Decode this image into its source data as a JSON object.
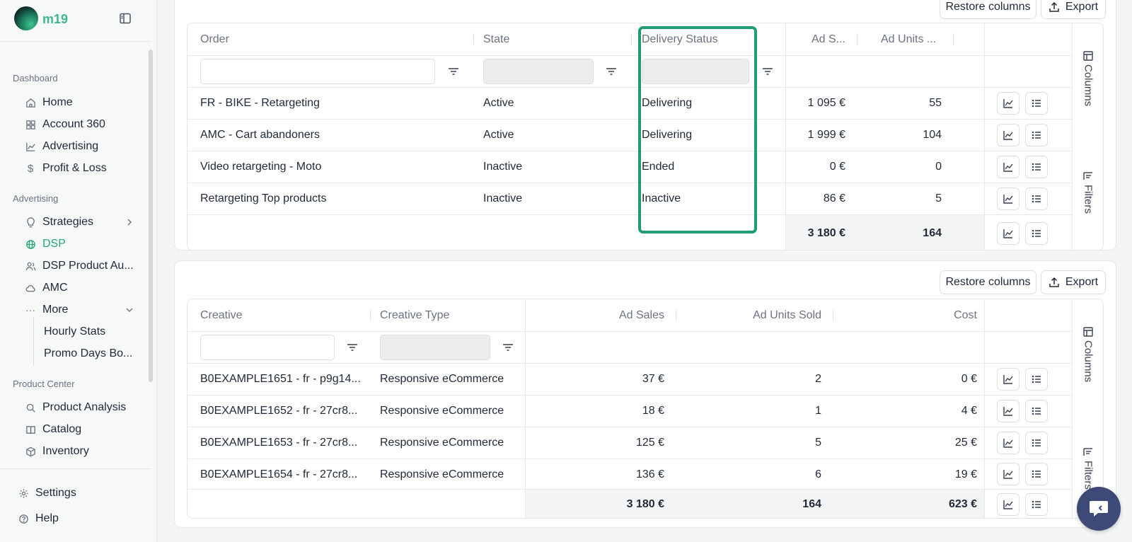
{
  "app": {
    "logo_text": "m19"
  },
  "sidebar": {
    "sections": [
      {
        "label": "Dashboard"
      },
      {
        "label": "Advertising"
      },
      {
        "label": "Product Center"
      }
    ],
    "items": [
      {
        "label": "Home",
        "icon": "home-icon"
      },
      {
        "label": "Account 360",
        "icon": "grid-icon"
      },
      {
        "label": "Advertising",
        "icon": "chart-line-icon"
      },
      {
        "label": "Profit & Loss",
        "icon": "dollar-icon"
      },
      {
        "label": "Strategies",
        "icon": "lightbulb-icon"
      },
      {
        "label": "DSP",
        "icon": "globe-icon",
        "active": true
      },
      {
        "label": "DSP Product Au...",
        "icon": "users-icon"
      },
      {
        "label": "AMC",
        "icon": "cloud-icon"
      },
      {
        "label": "More",
        "icon": "dots-icon"
      },
      {
        "label": "Product Analysis",
        "icon": "search-icon"
      },
      {
        "label": "Catalog",
        "icon": "book-icon"
      },
      {
        "label": "Inventory",
        "icon": "box-icon"
      }
    ],
    "sub_items": [
      {
        "label": "Hourly Stats"
      },
      {
        "label": "Promo Days Bo..."
      }
    ],
    "footer": [
      {
        "label": "Settings",
        "icon": "gear-icon"
      },
      {
        "label": "Help",
        "icon": "help-icon"
      }
    ],
    "active_color": "#23a874"
  },
  "orders_table": {
    "buttons": {
      "restore": "Restore columns",
      "export": "Export"
    },
    "headers": [
      "Order",
      "State",
      "Delivery Status",
      "Ad S...",
      "Ad Units ..."
    ],
    "rows": [
      {
        "order": "FR - BIKE - Retargeting",
        "state": "Active",
        "delivery": "Delivering",
        "ad_sales": "1 095 €",
        "ad_units": "55"
      },
      {
        "order": "AMC - Cart abandoners",
        "state": "Active",
        "delivery": "Delivering",
        "ad_sales": "1 999 €",
        "ad_units": "104"
      },
      {
        "order": "Video retargeting - Moto",
        "state": "Inactive",
        "delivery": "Ended",
        "ad_sales": "0 €",
        "ad_units": "0"
      },
      {
        "order": "Retargeting Top products",
        "state": "Inactive",
        "delivery": "Inactive",
        "ad_sales": "86 €",
        "ad_units": "5"
      }
    ],
    "totals": {
      "ad_sales": "3 180 €",
      "ad_units": "164"
    },
    "side_tabs": {
      "columns": "Columns",
      "filters": "Filters"
    },
    "highlight_color": "#1f9c74"
  },
  "creatives_table": {
    "buttons": {
      "restore": "Restore columns",
      "export": "Export"
    },
    "headers": [
      "Creative",
      "Creative Type",
      "Ad Sales",
      "Ad Units Sold",
      "Cost"
    ],
    "rows": [
      {
        "creative": "B0EXAMPLE1651 - fr - p9g14...",
        "type": "Responsive eCommerce",
        "ad_sales": "37 €",
        "ad_units": "2",
        "cost": "0 €"
      },
      {
        "creative": "B0EXAMPLE1652 - fr - 27cr8...",
        "type": "Responsive eCommerce",
        "ad_sales": "18 €",
        "ad_units": "1",
        "cost": "4 €"
      },
      {
        "creative": "B0EXAMPLE1653 - fr - 27cr8...",
        "type": "Responsive eCommerce",
        "ad_sales": "125 €",
        "ad_units": "5",
        "cost": "25 €"
      },
      {
        "creative": "B0EXAMPLE1654 - fr - 27cr8...",
        "type": "Responsive eCommerce",
        "ad_sales": "136 €",
        "ad_units": "6",
        "cost": "19 €"
      }
    ],
    "totals": {
      "ad_sales": "3 180 €",
      "ad_units": "164",
      "cost": "623 €"
    },
    "side_tabs": {
      "columns": "Columns",
      "filters": "Filters"
    }
  }
}
